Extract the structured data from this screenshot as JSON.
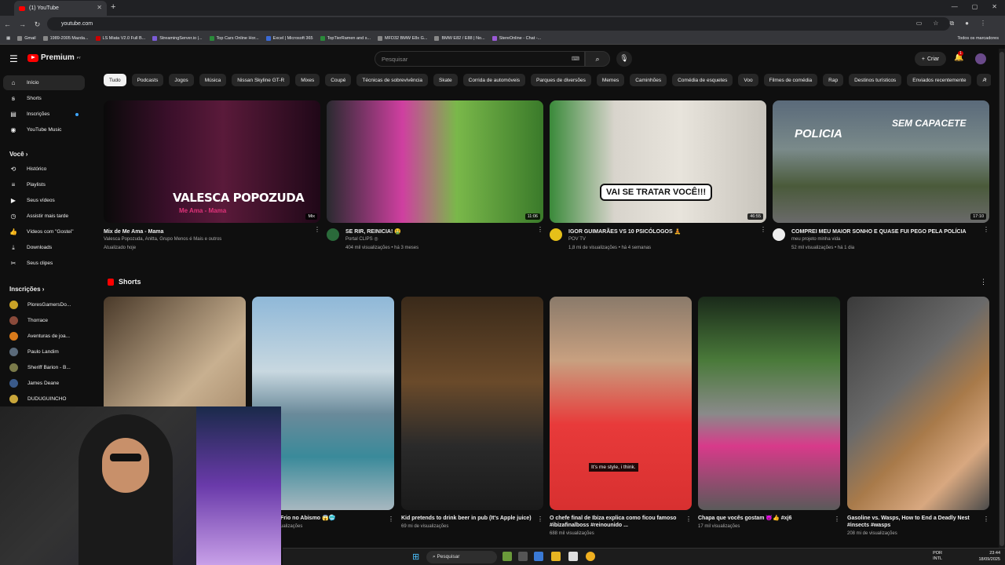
{
  "browser": {
    "tab_title": "(1) YouTube",
    "url": "youtube.com",
    "bookmarks": [
      "Gmail",
      "1989-2005 Mazda...",
      "LS Miata V2.0 Full B...",
      "StreamingServer.io |...",
      "Top Cars Online Hor...",
      "Excel | Microsoft 365",
      "TopTierRamen and s...",
      "MFD32 BMW E8x G...",
      "BMW E82 / E88 | No...",
      "StereOnline - Chat -..."
    ],
    "bookmarks_all": "Todos os marcadores"
  },
  "header": {
    "logo": "Premium",
    "logo_sup": "PT",
    "search_placeholder": "Pesquisar",
    "create_label": "Criar",
    "notif_count": "1"
  },
  "sidebar": {
    "main": [
      {
        "label": "Início",
        "icon": "home-icon"
      },
      {
        "label": "Shorts",
        "icon": "shorts-icon"
      },
      {
        "label": "Inscrições",
        "icon": "subscriptions-icon"
      },
      {
        "label": "YouTube Music",
        "icon": "music-icon"
      }
    ],
    "you_heading": "Você",
    "you": [
      {
        "label": "Histórico",
        "icon": "history-icon"
      },
      {
        "label": "Playlists",
        "icon": "playlist-icon"
      },
      {
        "label": "Seus vídeos",
        "icon": "video-icon"
      },
      {
        "label": "Assistir mais tarde",
        "icon": "clock-icon"
      },
      {
        "label": "Vídeos com \"Gostei\"",
        "icon": "like-icon"
      },
      {
        "label": "Downloads",
        "icon": "download-icon"
      },
      {
        "label": "Seus clipes",
        "icon": "scissors-icon"
      }
    ],
    "subs_heading": "Inscrições",
    "subs": [
      {
        "label": "PloresGamersDo...",
        "color": "#c9a227"
      },
      {
        "label": "Thorrace",
        "color": "#8a4a3a"
      },
      {
        "label": "Aventuras de joa...",
        "color": "#d97a1a"
      },
      {
        "label": "Paulo Landim",
        "color": "#5a6a7a"
      },
      {
        "label": "Sheriff Barion - B...",
        "color": "#7a7a4a"
      },
      {
        "label": "James Deane",
        "color": "#3a5a8a"
      },
      {
        "label": "DUDUGUINCHO",
        "color": "#c9a63a"
      }
    ]
  },
  "chips": [
    "Tudo",
    "Podcasts",
    "Jogos",
    "Música",
    "Nissan Skyline GT-R",
    "Mixes",
    "Coupé",
    "Técnicas de sobrevivência",
    "Skate",
    "Corrida de automóveis",
    "Parques de diversões",
    "Memes",
    "Caminhões",
    "Comédia de esquetes",
    "Voo",
    "Filmes de comédia",
    "Rap",
    "Destinos turísticos",
    "Enviados recentemente",
    "A"
  ],
  "videos": [
    {
      "title": "Mix de Me Ama - Mama",
      "channel": "Valesca Popozuda, Anitta, Grupo Menos é Mais e outros",
      "meta": "Atualizado hoje",
      "duration": "Mix",
      "thumb_text": "VALESCA POPOZUDA",
      "thumb_sub": "Me Ama - Mama"
    },
    {
      "title": "SE RIR, REINICIA! 🤮",
      "channel": "Portal CLIPS ◎",
      "meta": "404 mil visualizações • há 3 meses",
      "duration": "11:06",
      "thumb_text": "",
      "thumb_sub": ""
    },
    {
      "title": "IGOR GUIMARÃES VS 10 PSICÓLOGOS 🧘",
      "channel": "POV TV",
      "meta": "1,8 mi de visualizações • há 4 semanas",
      "duration": "46:55",
      "thumb_text": "VAI SE TRATAR VOCÊ!!!",
      "thumb_sub": ""
    },
    {
      "title": "COMPREI MEU MAIOR SONHO E QUASE FUI PEGO PELA POLÍCIA",
      "channel": "meu projeto minha vida",
      "meta": "52 mil visualizações • há 1 dia",
      "duration": "17:10",
      "thumb_text": "POLICIA",
      "thumb_sub": "SEM CAPACETE"
    }
  ],
  "shorts_heading": "Shorts",
  "shorts": [
    {
      "title": "",
      "meta": ""
    },
    {
      "title": "Frio no Abismo 😱🥶",
      "meta": "ualizações"
    },
    {
      "title": "Kid pretends to drink beer in pub (It's Apple juice)",
      "meta": "69 mi de visualizações"
    },
    {
      "title": "O chefe final de Ibiza explica como ficou famoso #ibizafinalboss #reinounido ...",
      "meta": "688 mil visualizações",
      "caption": "It's me style, i think."
    },
    {
      "title": "Chapa que vocês gostam 😈👍 #xj6",
      "meta": "17 mil visualizações"
    },
    {
      "title": "Gasoline vs. Wasps, How to End a Deadly Nest #insects #wasps",
      "meta": "208 mi de visualizações"
    }
  ],
  "taskbar": {
    "search": "Pesquisar",
    "lang1": "POR",
    "lang2": "INTL",
    "time": "23:44",
    "date": "18/09/2025"
  }
}
